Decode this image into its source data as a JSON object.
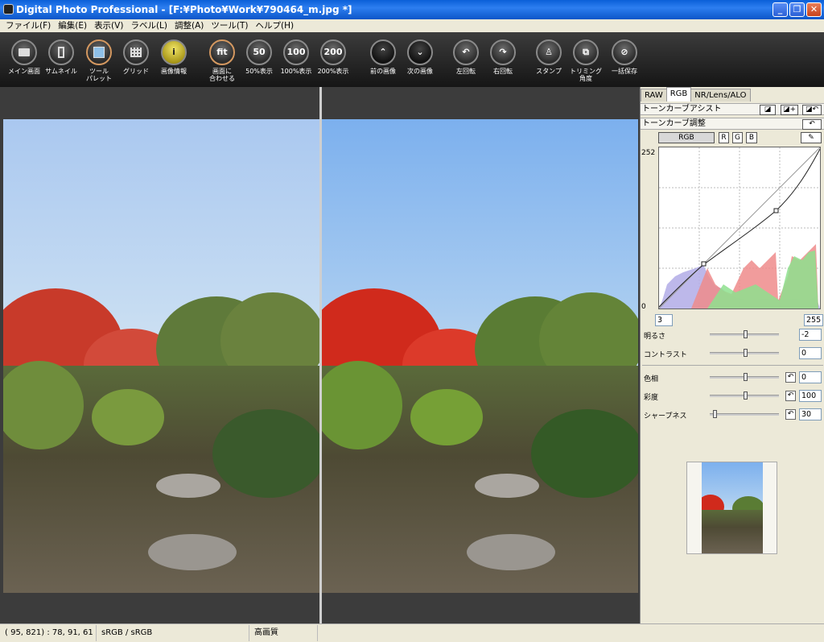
{
  "window": {
    "title": "Digital Photo Professional - [F:¥Photo¥Work¥790464_m.jpg *]"
  },
  "menu": [
    "ファイル(F)",
    "編集(E)",
    "表示(V)",
    "ラベル(L)",
    "調整(A)",
    "ツール(T)",
    "ヘルプ(H)"
  ],
  "toolbar": [
    {
      "label": "メイン画面",
      "icon": "folder-icon"
    },
    {
      "label": "サムネイル",
      "icon": "thumbnail-icon"
    },
    {
      "label": "ツール\nパレット",
      "icon": "tool-palette-icon"
    },
    {
      "label": "グリッド",
      "icon": "grid-icon"
    },
    {
      "label": "画像情報",
      "icon": "info-icon",
      "glyph": "i"
    },
    {
      "label": "画面に\n合わせる",
      "icon": "fit-icon",
      "glyph": "fit"
    },
    {
      "label": "50%表示",
      "icon": "zoom-50-icon",
      "glyph": "50"
    },
    {
      "label": "100%表示",
      "icon": "zoom-100-icon",
      "glyph": "100"
    },
    {
      "label": "200%表示",
      "icon": "zoom-200-icon",
      "glyph": "200"
    },
    {
      "label": "前の画像",
      "icon": "previous-image-icon",
      "glyph": "⌃"
    },
    {
      "label": "次の画像",
      "icon": "next-image-icon",
      "glyph": "⌄"
    },
    {
      "label": "左回転",
      "icon": "rotate-left-icon",
      "glyph": "↶"
    },
    {
      "label": "右回転",
      "icon": "rotate-right-icon",
      "glyph": "↷"
    },
    {
      "label": "スタンプ",
      "icon": "stamp-icon",
      "glyph": "♙"
    },
    {
      "label": "トリミング\n角度",
      "icon": "trim-icon",
      "glyph": "⧉"
    },
    {
      "label": "一括保存",
      "icon": "batch-save-icon",
      "glyph": "⊘"
    }
  ],
  "panel": {
    "tabs": [
      "RAW",
      "RGB",
      "NR/Lens/ALO"
    ],
    "active_tab": "RGB",
    "tone_assist_label": "トーンカーブアシスト",
    "tone_adjust_label": "トーンカーブ調整",
    "channels": [
      "RGB",
      "R",
      "G",
      "B"
    ],
    "curve_max": "252",
    "curve_min": "0",
    "input_low": "3",
    "input_high": "255",
    "brightness_label": "明るさ",
    "brightness_value": "-2",
    "contrast_label": "コントラスト",
    "contrast_value": "0",
    "hue_label": "色相",
    "hue_value": "0",
    "saturation_label": "彩度",
    "saturation_value": "100",
    "sharpness_label": "シャープネス",
    "sharpness_value": "30"
  },
  "status": {
    "coords": "( 95, 821) : 78, 91, 61",
    "colorspace": "sRGB / sRGB",
    "quality": "高画質"
  }
}
